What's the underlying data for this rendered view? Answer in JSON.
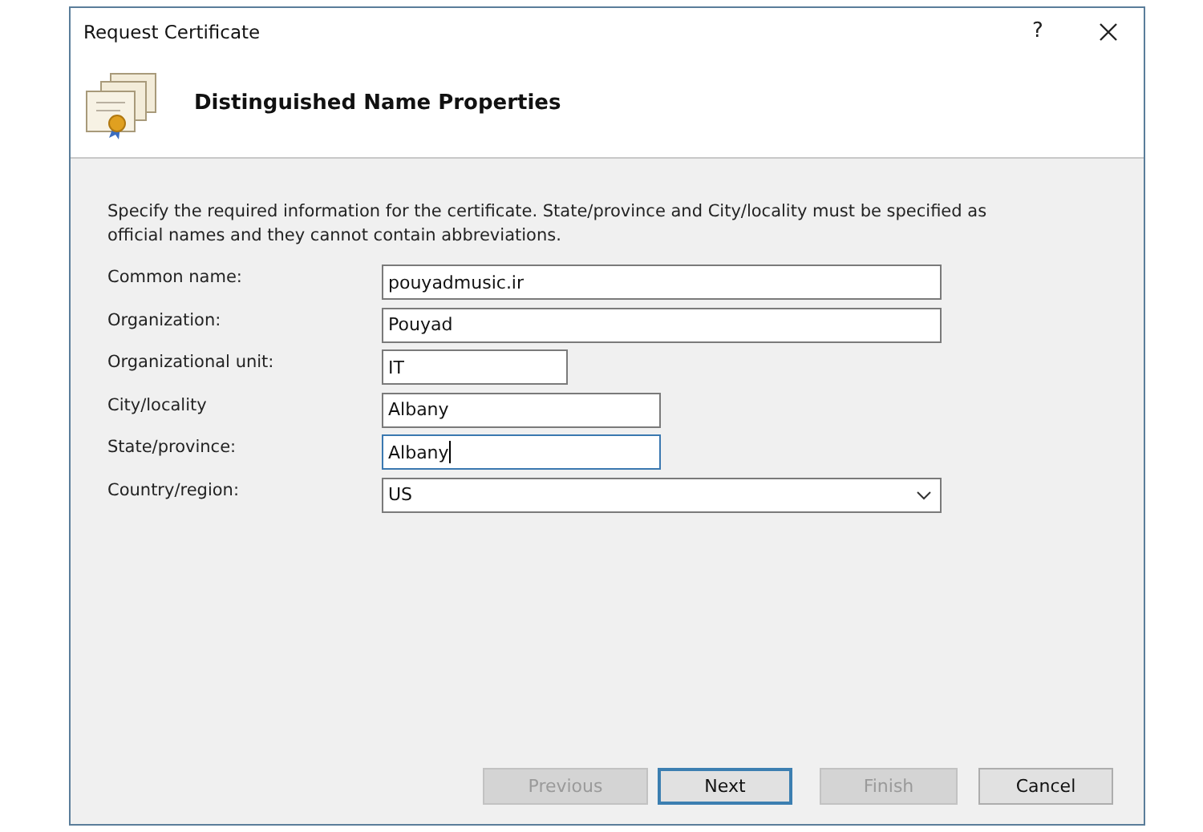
{
  "window": {
    "title": "Request Certificate",
    "help": "?"
  },
  "header": {
    "title": "Distinguished Name Properties"
  },
  "description": "Specify the required information for the certificate. State/province and City/locality must be specified as official names and they cannot contain abbreviations.",
  "fields": [
    {
      "label": "Common name:",
      "kind": "text",
      "value": "pouyadmusic.ir",
      "focused": false
    },
    {
      "label": "Organization:",
      "kind": "text",
      "value": "Pouyad",
      "focused": false
    },
    {
      "label": "Organizational unit:",
      "kind": "text",
      "value": "IT",
      "focused": false
    },
    {
      "label": "City/locality",
      "kind": "text",
      "value": "Albany",
      "focused": false
    },
    {
      "label": "State/province:",
      "kind": "text",
      "value": "Albany",
      "focused": true
    },
    {
      "label": "Country/region:",
      "kind": "dropdown",
      "value": "US",
      "focused": false
    }
  ],
  "buttons": [
    {
      "label": "Previous",
      "disabled": true,
      "default": false
    },
    {
      "label": "Next",
      "disabled": false,
      "default": true
    },
    {
      "label": "Finish",
      "disabled": true,
      "default": false
    },
    {
      "label": "Cancel",
      "disabled": false,
      "default": false
    }
  ]
}
